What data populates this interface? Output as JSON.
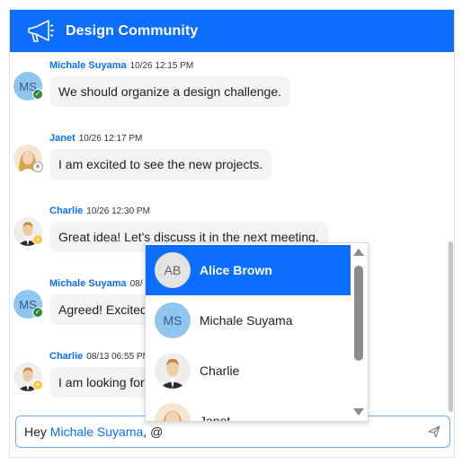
{
  "header": {
    "title": "Design Community",
    "icon": "megaphone-icon"
  },
  "messages": [
    {
      "name": "Michale Suyama",
      "time": "10/26 12:15 PM",
      "text": "We should organize a design challenge.",
      "avatar": {
        "type": "initials",
        "initials": "MS"
      },
      "status": "online"
    },
    {
      "name": "Janet",
      "time": "10/26 12:17 PM",
      "text": "I am excited to see the new projects.",
      "avatar": {
        "type": "photo"
      },
      "status": "offline"
    },
    {
      "name": "Charlie",
      "time": "10/26 12:30 PM",
      "text": "Great idea! Let's discuss it in the next meeting.",
      "avatar": {
        "type": "photo"
      },
      "status": "away"
    },
    {
      "name": "Michale Suyama",
      "time": "08/",
      "text": "Agreed! Excited",
      "avatar": {
        "type": "initials",
        "initials": "MS"
      },
      "status": "online"
    },
    {
      "name": "Charlie",
      "time": "08/13 06:55 PM",
      "text": "I am looking for",
      "avatar": {
        "type": "photo"
      },
      "status": "away"
    }
  ],
  "mention_popup": {
    "items": [
      {
        "label": "Alice Brown",
        "initials": "AB",
        "selected": true
      },
      {
        "label": "Michale Suyama",
        "initials": "MS",
        "selected": false
      },
      {
        "label": "Charlie",
        "initials": "",
        "selected": false
      },
      {
        "label": "Janet",
        "initials": "",
        "selected": false
      }
    ]
  },
  "composer": {
    "prefix": "Hey ",
    "mention": "Michale Suyama",
    "suffix": ", @",
    "send_icon": "send-icon"
  },
  "colors": {
    "accent": "#0d6efd",
    "status_online": "#2e8b3a",
    "status_away": "#f7c948"
  }
}
